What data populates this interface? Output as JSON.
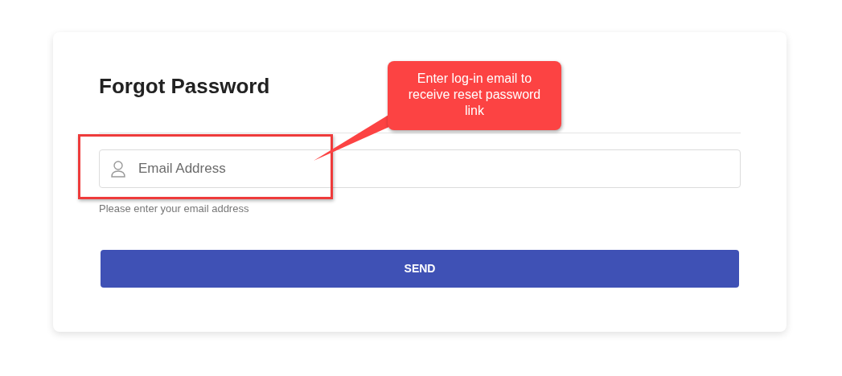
{
  "form": {
    "title": "Forgot Password",
    "email_field": {
      "placeholder": "Email Address",
      "help": "Please enter your email address"
    },
    "submit_button": {
      "label": "SEND"
    }
  },
  "annotation": {
    "text": "Enter log-in email to receive reset password link"
  }
}
